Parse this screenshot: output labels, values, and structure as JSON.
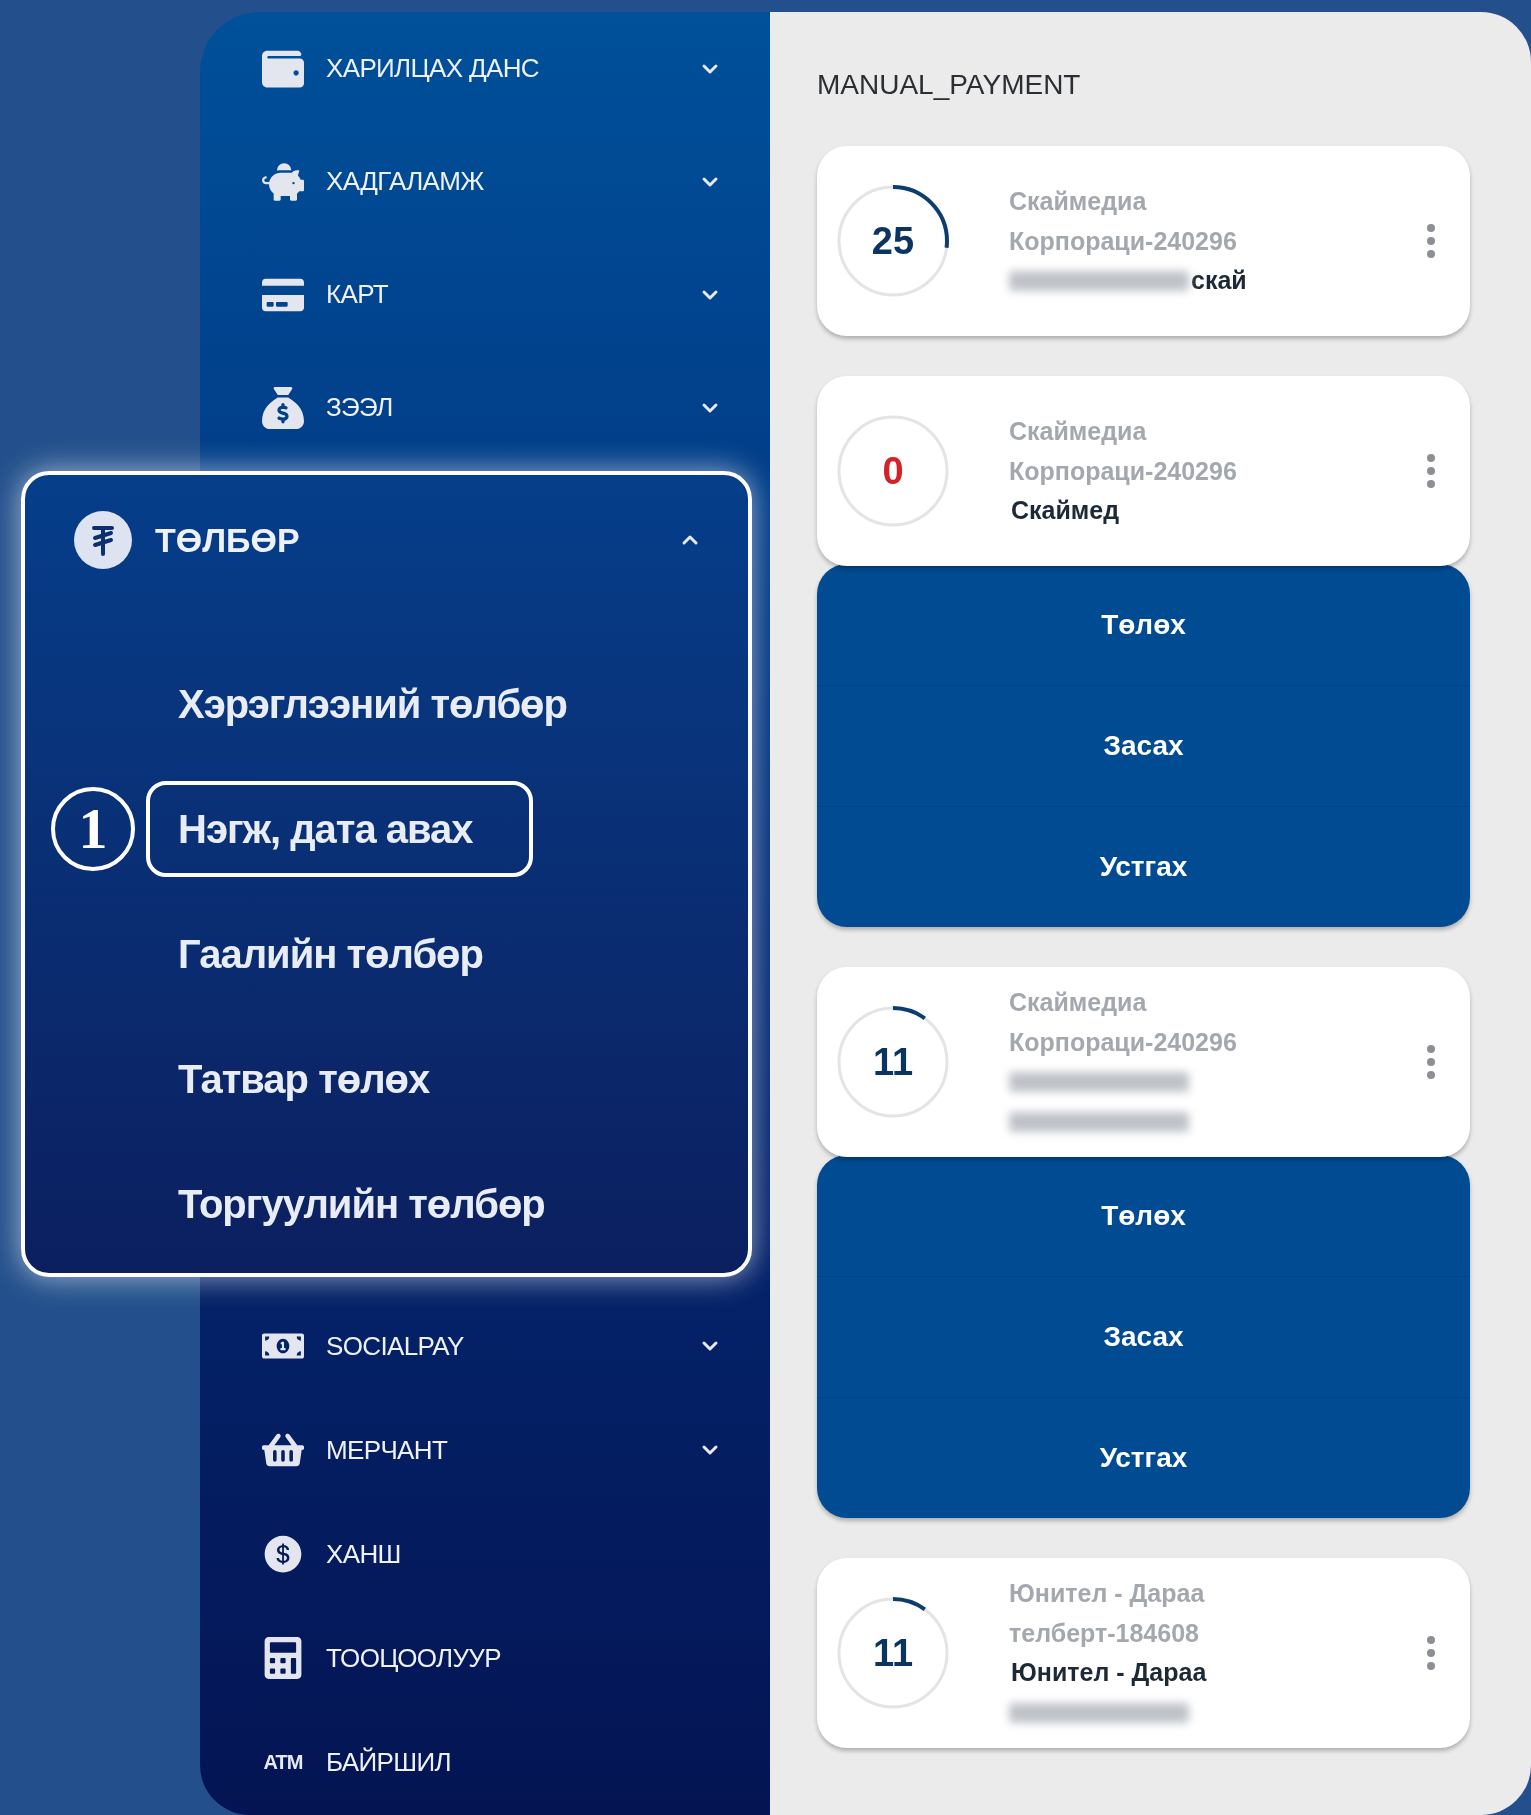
{
  "sidebar": {
    "items_top": [
      {
        "kind": "icon",
        "label": "ХАРИЛЦАХ ДАНС",
        "expanded": false
      },
      {
        "kind": "icon",
        "label": "ХАДГАЛАМЖ",
        "expanded": false
      },
      {
        "kind": "icon",
        "label": "КАРТ",
        "expanded": false
      },
      {
        "kind": "icon",
        "label": "ЗЭЭЛ",
        "expanded": false
      }
    ],
    "items_bottom": [
      {
        "kind": "icon",
        "label": "SOCIALPAY",
        "expanded": false
      },
      {
        "kind": "icon",
        "label": "МЕРЧАНТ",
        "expanded": false
      },
      {
        "kind": "icon",
        "label": "ХАНШ"
      },
      {
        "kind": "icon",
        "label": "ТООЦООЛУУР"
      },
      {
        "kind": "text-icon",
        "icon_text": "ATM",
        "label": "БАЙРШИЛ"
      }
    ]
  },
  "highlight": {
    "title": "ТӨЛБӨР",
    "expanded": true,
    "items": [
      {
        "label": "Хэрэглээний төлбөр",
        "selected": false
      },
      {
        "label": "Нэгж, дата авах",
        "selected": true,
        "callout": "1"
      },
      {
        "label": "Гаалийн төлбөр",
        "selected": false
      },
      {
        "label": "Татвар төлөх",
        "selected": false
      },
      {
        "label": "Торгуулийн төлбөр",
        "selected": false
      }
    ]
  },
  "panel": {
    "title": "MANUAL_PAYMENT",
    "cards": [
      {
        "count": "25",
        "alert": false,
        "title_lines": [
          "Скаймедиа",
          "Корпораци-240296"
        ],
        "detail_lines": [
          [
            {
              "kind": "blur"
            },
            {
              "kind": "text",
              "text": "скай"
            }
          ]
        ]
      },
      {
        "count": "0",
        "alert": true,
        "title_lines": [
          "Скаймедиа",
          "Корпораци-240296"
        ],
        "detail_lines": [
          [
            {
              "kind": "text",
              "text": "Скаймед"
            }
          ]
        ],
        "actions": [
          "Төлөх",
          "Засах",
          "Устгах"
        ]
      },
      {
        "count": "11",
        "alert": false,
        "title_lines": [
          "Скаймедиа",
          "Корпораци-240296"
        ],
        "detail_lines": [
          [
            {
              "kind": "blur"
            }
          ],
          [
            {
              "kind": "blur"
            }
          ]
        ],
        "actions": [
          "Төлөх",
          "Засах",
          "Устгах"
        ]
      },
      {
        "count": "11",
        "alert": false,
        "title_lines": [
          "Юнител - Дараа",
          "телберт-184608"
        ],
        "detail_lines": [
          [
            {
              "kind": "text",
              "text": "Юнител - Дараа"
            }
          ],
          [
            {
              "kind": "blur"
            }
          ]
        ]
      }
    ]
  }
}
